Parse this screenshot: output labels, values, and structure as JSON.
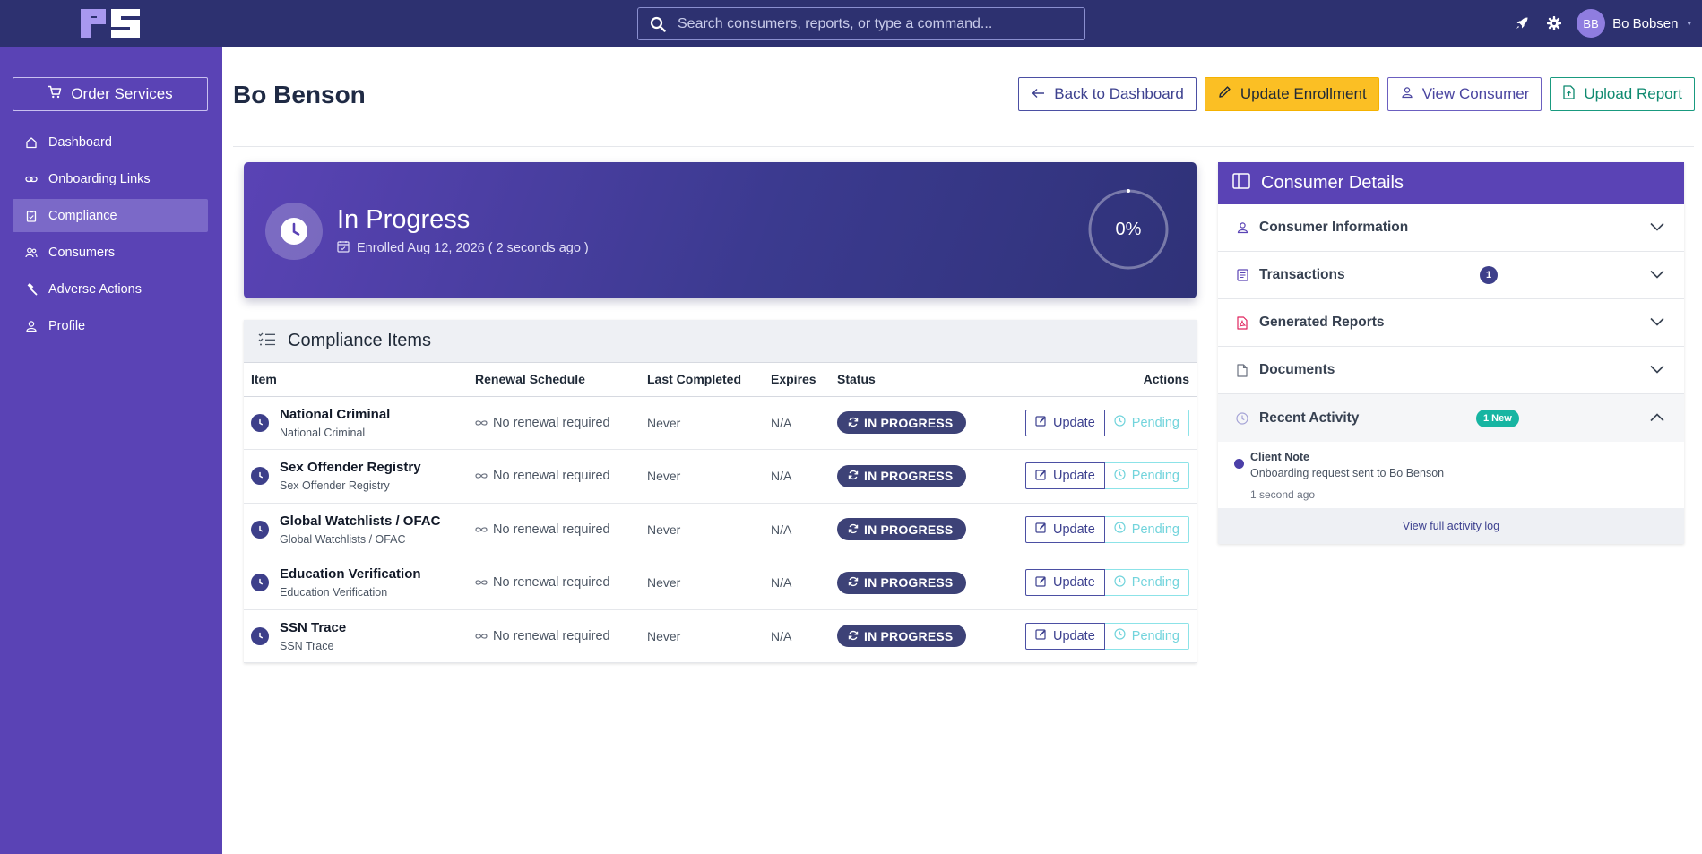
{
  "search": {
    "placeholder": "Search consumers, reports, or type a command..."
  },
  "user": {
    "initials": "BB",
    "name": "Bo Bobsen"
  },
  "sidebar": {
    "order_label": "Order Services",
    "items": [
      {
        "label": "Dashboard",
        "icon": "home-icon"
      },
      {
        "label": "Onboarding Links",
        "icon": "link-icon"
      },
      {
        "label": "Compliance",
        "icon": "clipboard-icon",
        "active": true
      },
      {
        "label": "Consumers",
        "icon": "users-icon"
      },
      {
        "label": "Adverse Actions",
        "icon": "gavel-icon"
      },
      {
        "label": "Profile",
        "icon": "user-icon"
      }
    ]
  },
  "header": {
    "title": "Bo Benson",
    "back_label": "Back to Dashboard",
    "update_label": "Update Enrollment",
    "view_label": "View Consumer",
    "upload_label": "Upload Report"
  },
  "status": {
    "title": "In Progress",
    "enrolled": "Enrolled Aug 12, 2026 ( 2 seconds ago )",
    "percent_label": "0%",
    "progress": 0
  },
  "compliance": {
    "title": "Compliance Items",
    "columns": [
      "Item",
      "Renewal Schedule",
      "Last Completed",
      "Expires",
      "Status",
      "Actions"
    ],
    "rows": [
      {
        "name": "National Criminal",
        "sub": "National Criminal",
        "renewal": "No renewal required",
        "last": "Never",
        "expires": "N/A",
        "status": "IN PROGRESS"
      },
      {
        "name": "Sex Offender Registry",
        "sub": "Sex Offender Registry",
        "renewal": "No renewal required",
        "last": "Never",
        "expires": "N/A",
        "status": "IN PROGRESS"
      },
      {
        "name": "Global Watchlists / OFAC",
        "sub": "Global Watchlists / OFAC",
        "renewal": "No renewal required",
        "last": "Never",
        "expires": "N/A",
        "status": "IN PROGRESS"
      },
      {
        "name": "Education Verification",
        "sub": "Education Verification",
        "renewal": "No renewal required",
        "last": "Never",
        "expires": "N/A",
        "status": "IN PROGRESS"
      },
      {
        "name": "SSN Trace",
        "sub": "SSN Trace",
        "renewal": "No renewal required",
        "last": "Never",
        "expires": "N/A",
        "status": "IN PROGRESS"
      }
    ],
    "update_label": "Update",
    "pending_label": "Pending"
  },
  "details": {
    "title": "Consumer Details",
    "sections": {
      "info": "Consumer Information",
      "transactions": "Transactions",
      "transactions_count": "1",
      "reports": "Generated Reports",
      "documents": "Documents",
      "activity": "Recent Activity",
      "activity_badge": "1 New"
    },
    "activity": {
      "title": "Client Note",
      "text": "Onboarding request sent to Bo Benson",
      "time": "1 second ago"
    },
    "full_log_label": "View full activity log"
  },
  "colors": {
    "topbar": "#2d3170",
    "sidebar": "#5a43b5",
    "accent_yellow": "#fbbf24",
    "accent_teal": "#17b5a2"
  }
}
